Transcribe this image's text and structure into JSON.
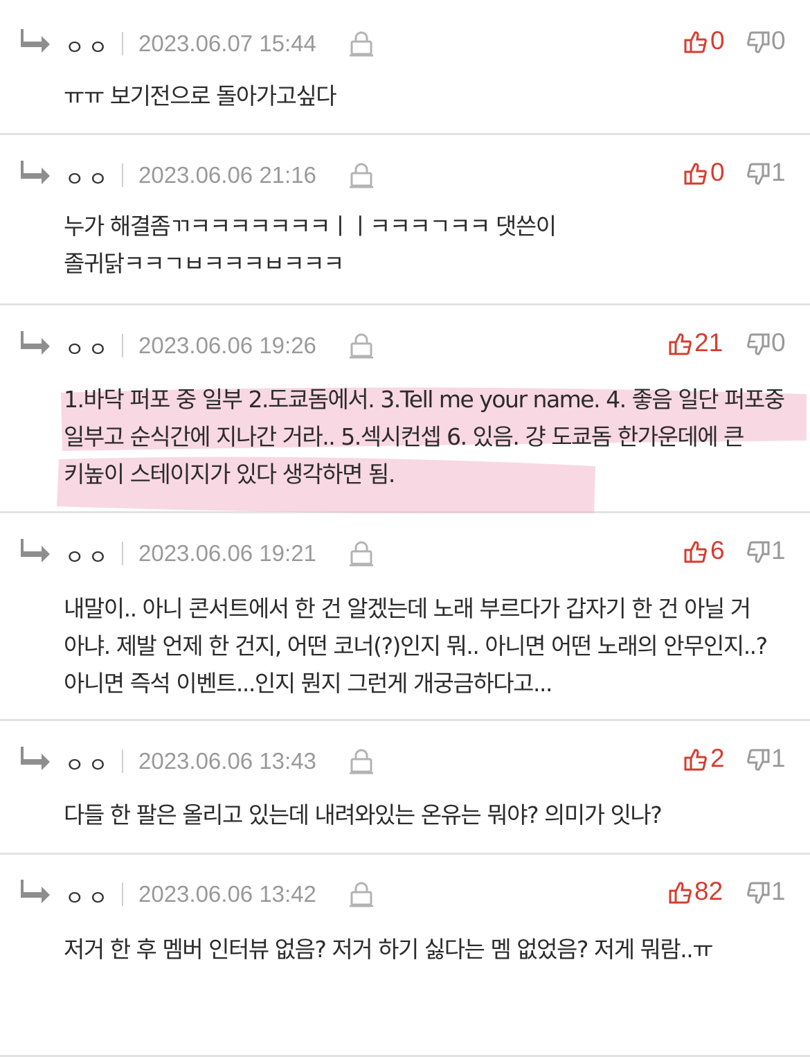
{
  "comments": [
    {
      "author": "ㅇㅇ",
      "date": "2023.06.07 15:44",
      "likes": "0",
      "dislikes": "0",
      "text": "ㅠㅠ 보기전으로 돌아가고싶다"
    },
    {
      "author": "ㅇㅇ",
      "date": "2023.06.06 21:16",
      "likes": "0",
      "dislikes": "1",
      "text": "누가 해결좀ㄲㅋㅋㅋㅋㅋㅋㅋㅣㅣㅋㅋㅋㄱㅋㅋ 댓쓴이 졸귀닭ㅋㅋㄱㅂㅋㅋㅋㅂㅋㅋㅋ"
    },
    {
      "author": "ㅇㅇ",
      "date": "2023.06.06 19:26",
      "likes": "21",
      "dislikes": "0",
      "text": "1.바닥 퍼포 중 일부 2.도쿄돔에서. 3.Tell me your name. 4. 좋음 일단 퍼포중 일부고 순식간에 지나간 거라.. 5.섹시컨셉 6. 있음. 걍 도쿄돔 한가운데에 큰 키높이 스테이지가 있다 생각하면 됨."
    },
    {
      "author": "ㅇㅇ",
      "date": "2023.06.06 19:21",
      "likes": "6",
      "dislikes": "1",
      "text": "내말이.. 아니 콘서트에서 한 건 알겠는데 노래 부르다가 갑자기 한 건 아닐 거 아냐. 제발 언제 한 건지, 어떤 코너(?)인지 뭐.. 아니면 어떤 노래의 안무인지..? 아니면 즉석 이벤트...인지 뭔지 그런게 개궁금하다고..."
    },
    {
      "author": "ㅇㅇ",
      "date": "2023.06.06 13:43",
      "likes": "2",
      "dislikes": "1",
      "text": "다들 한 팔은 올리고 있는데 내려와있는 온유는 뭐야? 의미가 잇나?"
    },
    {
      "author": "ㅇㅇ",
      "date": "2023.06.06 13:42",
      "likes": "82",
      "dislikes": "1",
      "text": "저거 한 후 멤버 인터뷰 없음? 저거 하기 싫다는 멤 없었음? 저게 뭐람..ㅠ"
    }
  ],
  "colors": {
    "like": "#d63c2e",
    "dislike": "#999999",
    "meta": "#999999",
    "divider": "#e2e2e2",
    "highlight": "#f2b8cc"
  },
  "icons": {
    "reply": "reply-arrow-icon",
    "lock": "lock-icon",
    "up": "thumbs-up-icon",
    "down": "thumbs-down-icon"
  }
}
